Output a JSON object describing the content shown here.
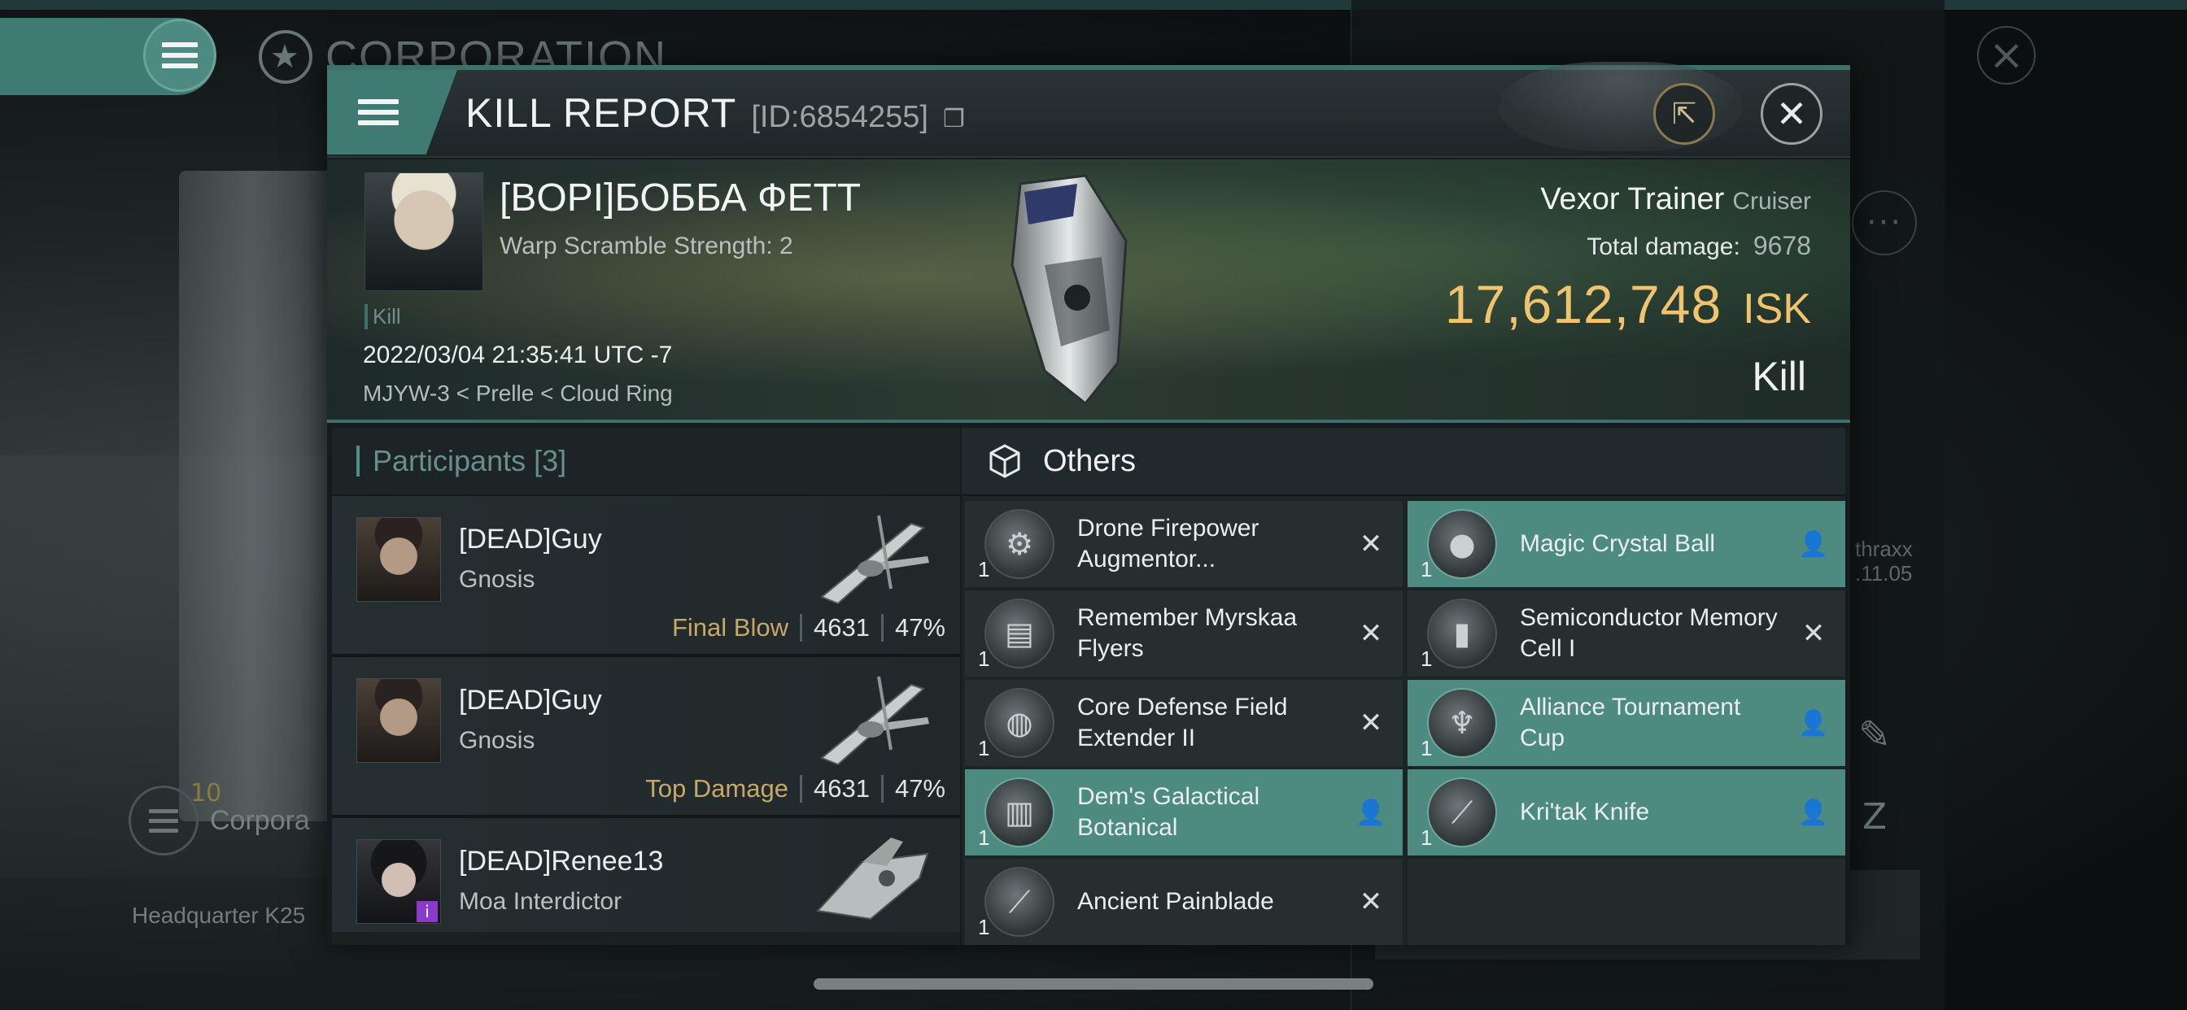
{
  "background": {
    "corporation_title": "CORPORATION",
    "corp_count": "10",
    "corp_label": "Corpora",
    "hq_label": "Headquarter K25",
    "peek_name_1": "thraxx",
    "peek_name_2": ".11.05"
  },
  "header": {
    "title": "KILL REPORT",
    "id_text": "[ID:6854255]",
    "copy_icon": "copy-icon",
    "external_icon": "external-link-icon",
    "close_icon": "close-icon"
  },
  "victim": {
    "name": "[BOPI]БОББА ФЕТТ",
    "subtitle": "Warp Scramble Strength: 2",
    "kill_tag": "Kill",
    "datetime": "2022/03/04 21:35:41 UTC -7",
    "location": "MJYW-3 < Prelle < Cloud Ring",
    "ship_name": "Vexor Trainer",
    "ship_class": "Cruiser",
    "total_damage_label": "Total damage:",
    "total_damage": "9678",
    "isk_value": "17,612,748",
    "isk_unit": "ISK",
    "report_type": "Kill"
  },
  "participants": {
    "label": "Participants",
    "count": "[3]",
    "rows": [
      {
        "name": "[DEAD]Guy",
        "ship": "Gnosis",
        "tag": "Final Blow",
        "damage": "4631",
        "percent": "47%"
      },
      {
        "name": "[DEAD]Guy",
        "ship": "Gnosis",
        "tag": "Top Damage",
        "damage": "4631",
        "percent": "47%"
      },
      {
        "name": "[DEAD]Renee13",
        "ship": "Moa Interdictor",
        "tag": "",
        "damage": "",
        "percent": ""
      }
    ]
  },
  "others": {
    "label": "Others",
    "items": [
      {
        "qty": "1",
        "name": "Drone Firepower Augmentor...",
        "status": "destroyed"
      },
      {
        "qty": "1",
        "name": "Magic Crystal Ball",
        "status": "dropped"
      },
      {
        "qty": "1",
        "name": "Remember Myrskaa Flyers",
        "status": "destroyed"
      },
      {
        "qty": "1",
        "name": "Semiconductor Memory Cell I",
        "status": "destroyed"
      },
      {
        "qty": "1",
        "name": "Core Defense Field Extender II",
        "status": "destroyed"
      },
      {
        "qty": "1",
        "name": "Alliance Tournament Cup",
        "status": "dropped"
      },
      {
        "qty": "1",
        "name": "Dem's Galactical Botanical",
        "status": "dropped"
      },
      {
        "qty": "1",
        "name": "Kri'tak Knife",
        "status": "dropped"
      },
      {
        "qty": "1",
        "name": "Ancient Painblade",
        "status": "destroyed"
      }
    ]
  },
  "colors": {
    "accent_teal": "#3d7068",
    "dropped_bg": "#4d8a80",
    "isk_gold": "#f0c46f",
    "tag_gold": "#c7a868"
  }
}
